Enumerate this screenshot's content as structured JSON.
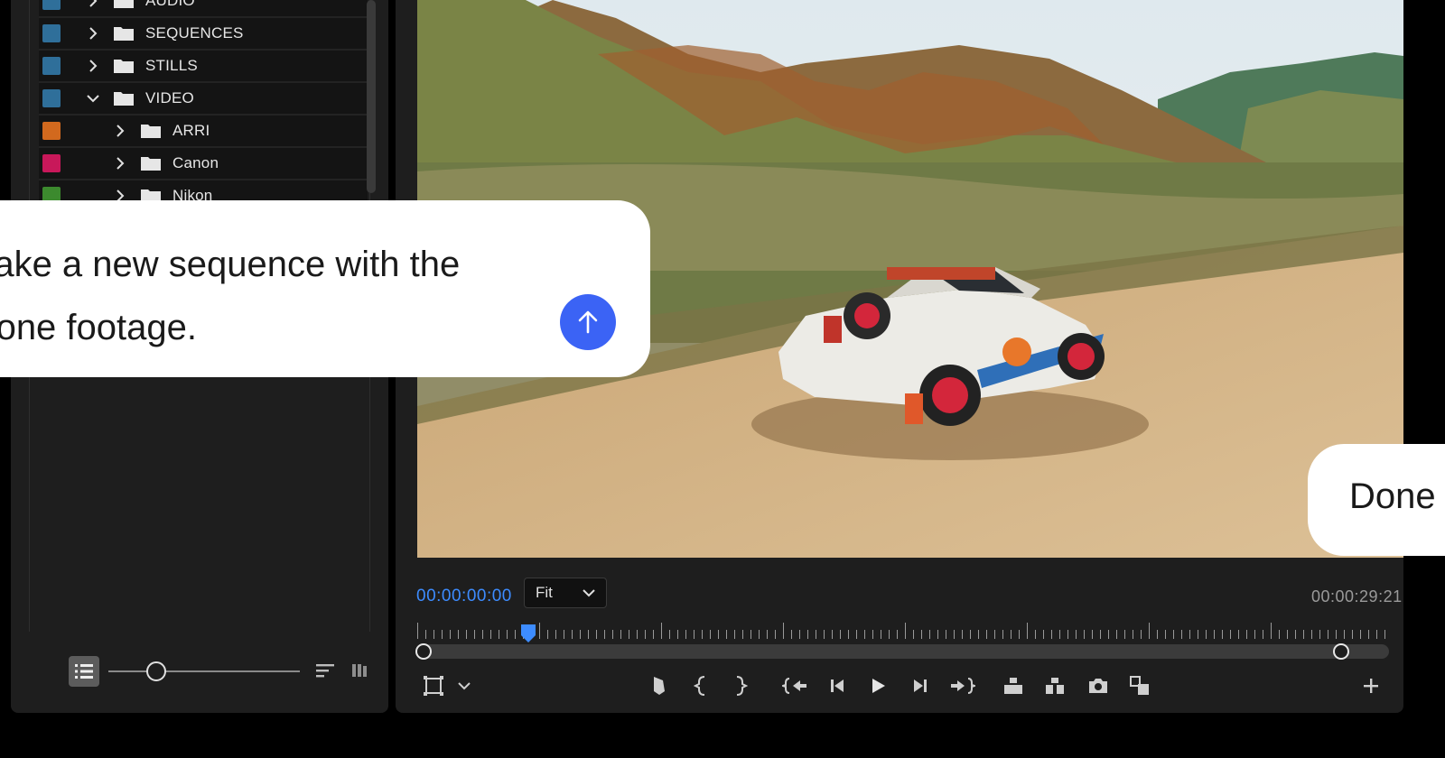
{
  "project": {
    "bins": [
      {
        "label": "AUDIO",
        "color": "#2f6f9a",
        "expanded": false
      },
      {
        "label": "SEQUENCES",
        "color": "#2f6f9a",
        "expanded": false
      },
      {
        "label": "STILLS",
        "color": "#2f6f9a",
        "expanded": false
      },
      {
        "label": "VIDEO",
        "color": "#2f6f9a",
        "expanded": true
      },
      {
        "label": "ARRI",
        "color": "#d2691e",
        "expanded": false
      },
      {
        "label": "Canon",
        "color": "#c8185a",
        "expanded": false
      },
      {
        "label": "Nikon",
        "color": "#3c8a2e",
        "expanded": false
      }
    ],
    "icons": {
      "list_view": "list-view-icon",
      "sort": "sort-icon",
      "bins": "bins-icon"
    }
  },
  "monitor": {
    "timecode_current": "00:00:00:00",
    "fit": "Fit",
    "timecode_duration": "00:00:29:21",
    "playhead_position": 0,
    "transport_icons": [
      "safe-margins-icon",
      "settings-chevron-icon",
      "add-marker-icon",
      "mark-in-icon",
      "mark-out-icon",
      "go-to-in-icon",
      "step-back-icon",
      "play-icon",
      "step-forward-icon",
      "go-to-out-icon",
      "lift-icon",
      "extract-icon",
      "export-frame-icon",
      "comparison-view-icon",
      "add-button-icon"
    ],
    "accent_color": "#3d8cff"
  },
  "chat": {
    "prompt": "Make a new sequence with the\ndrone footage.",
    "send_icon": "arrow-up-icon",
    "send_color": "#3b63f5",
    "reply": "Done"
  }
}
